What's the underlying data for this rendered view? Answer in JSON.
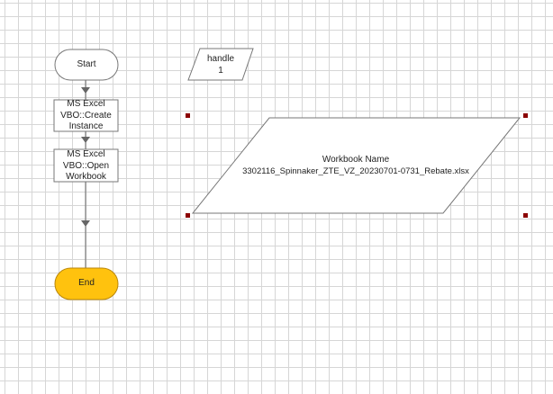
{
  "flowchart": {
    "start_label": "Start",
    "end_label": "End",
    "action_create": {
      "line1": "MS Excel",
      "line2": "VBO::Create",
      "line3": "Instance"
    },
    "action_open": {
      "line1": "MS Excel",
      "line2": "VBO::Open",
      "line3": "Workbook"
    },
    "data_handle": {
      "line1": "handle",
      "line2": "1"
    },
    "data_workbook": {
      "line1": "Workbook Name",
      "line2": "3302116_Spinnaker_ZTE_VZ_20230701-0731_Rebate.xlsx"
    }
  },
  "colors": {
    "end_fill": "#ffc20e",
    "line": "#666666",
    "selection_handle": "#8b0000"
  }
}
